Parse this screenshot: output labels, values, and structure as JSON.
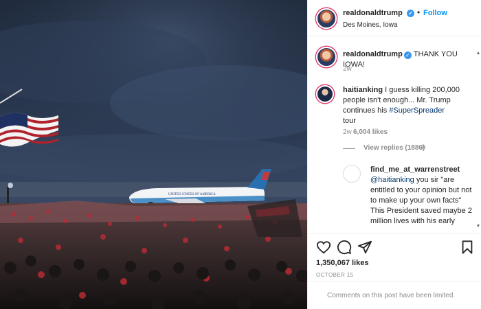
{
  "post": {
    "username": "realdonaldtrump",
    "verified_icon": "verified-badge-icon",
    "follow_label": "Follow",
    "location": "Des Moines, Iowa",
    "caption": "THANK YOU IOWA!",
    "caption_time": "2w"
  },
  "comment": {
    "username": "haitianking",
    "text_before_tag": "I guess killing 200,000 people isn't enough... Mr. Trump continues his",
    "hashtag": "#SuperSpreader",
    "text_after_tag": "tour",
    "time": "2w",
    "likes": "6,004 likes",
    "view_replies": "View replies (1886)"
  },
  "reply": {
    "username": "find_me_at_warrenstreet",
    "mention": "@haitianking",
    "text": "you sir \"are entitled to your opinion but not to make up your own facts\" This President saved maybe 2 million lives with his early"
  },
  "actions": {
    "likes": "1,350,067 likes",
    "date": "OCTOBER 15",
    "limited_notice": "Comments on this post have been limited."
  },
  "colors": {
    "accent": "#0095f6",
    "verified": "#3897f0",
    "muted": "#8e8e8e",
    "text": "#262626"
  },
  "photo": {
    "aircraft_marking": "UNITED STATES OF AMERICA"
  }
}
